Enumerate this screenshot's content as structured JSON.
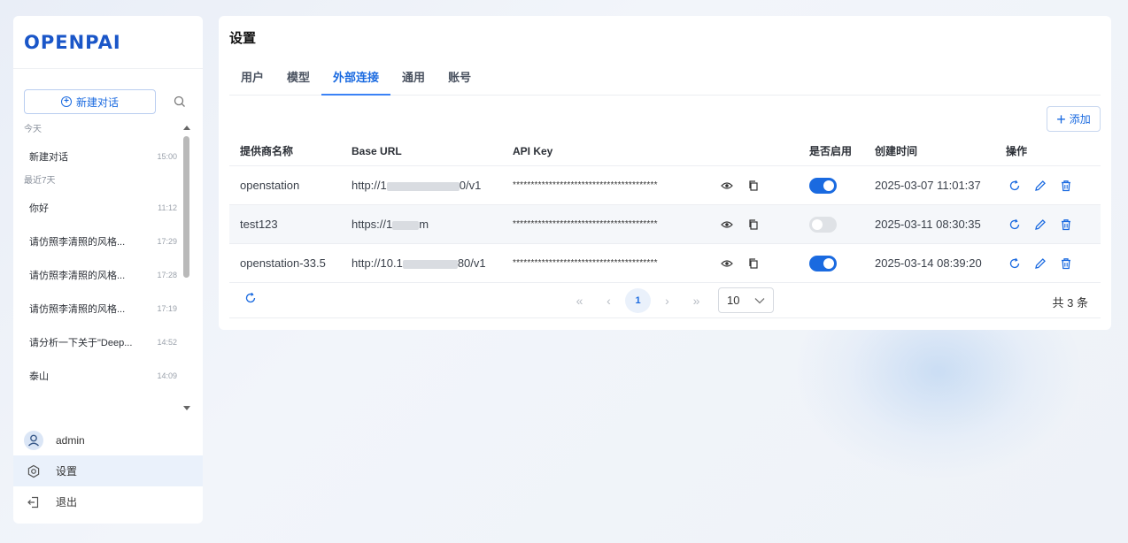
{
  "app": {
    "logo": "OPENPAI"
  },
  "sidebar": {
    "new_chat_label": "新建对话",
    "groups": [
      {
        "label": "今天",
        "items": [
          {
            "title": "新建对话",
            "time": "15:00"
          }
        ]
      },
      {
        "label": "最近7天",
        "items": [
          {
            "title": "你好",
            "time": "11:12"
          },
          {
            "title": "请仿照李清照的风格...",
            "time": "17:29"
          },
          {
            "title": "请仿照李清照的风格...",
            "time": "17:28"
          },
          {
            "title": "请仿照李清照的风格...",
            "time": "17:19"
          },
          {
            "title": "请分析一下关于\"Deep...",
            "time": "14:52"
          },
          {
            "title": "泰山",
            "time": "14:09"
          }
        ]
      }
    ],
    "user": "admin",
    "settings_label": "设置",
    "logout_label": "退出"
  },
  "settings": {
    "title": "设置",
    "tabs": [
      "用户",
      "模型",
      "外部连接",
      "通用",
      "账号"
    ],
    "active_tab": "外部连接",
    "add_label": "添加",
    "columns": [
      "提供商名称",
      "Base URL",
      "API Key",
      "是否启用",
      "创建时间",
      "操作"
    ],
    "rows": [
      {
        "name": "openstation",
        "url_prefix": "http://1",
        "url_suffix": "0/v1",
        "api_key": "****************************************",
        "enabled": true,
        "created": "2025-03-07 11:01:37"
      },
      {
        "name": "test123",
        "url_prefix": "https://1",
        "url_suffix": "m",
        "api_key": "****************************************",
        "enabled": false,
        "created": "2025-03-11 08:30:35"
      },
      {
        "name": "openstation-33.5",
        "url_prefix": "http://10.1",
        "url_suffix": "80/v1",
        "api_key": "****************************************",
        "enabled": true,
        "created": "2025-03-14 08:39:20"
      }
    ],
    "pagination": {
      "current_page": "1",
      "page_size": "10",
      "total_text": "共 3 条"
    }
  },
  "colors": {
    "accent": "#1a6ae0",
    "toggle_off": "#dfe2e6"
  }
}
